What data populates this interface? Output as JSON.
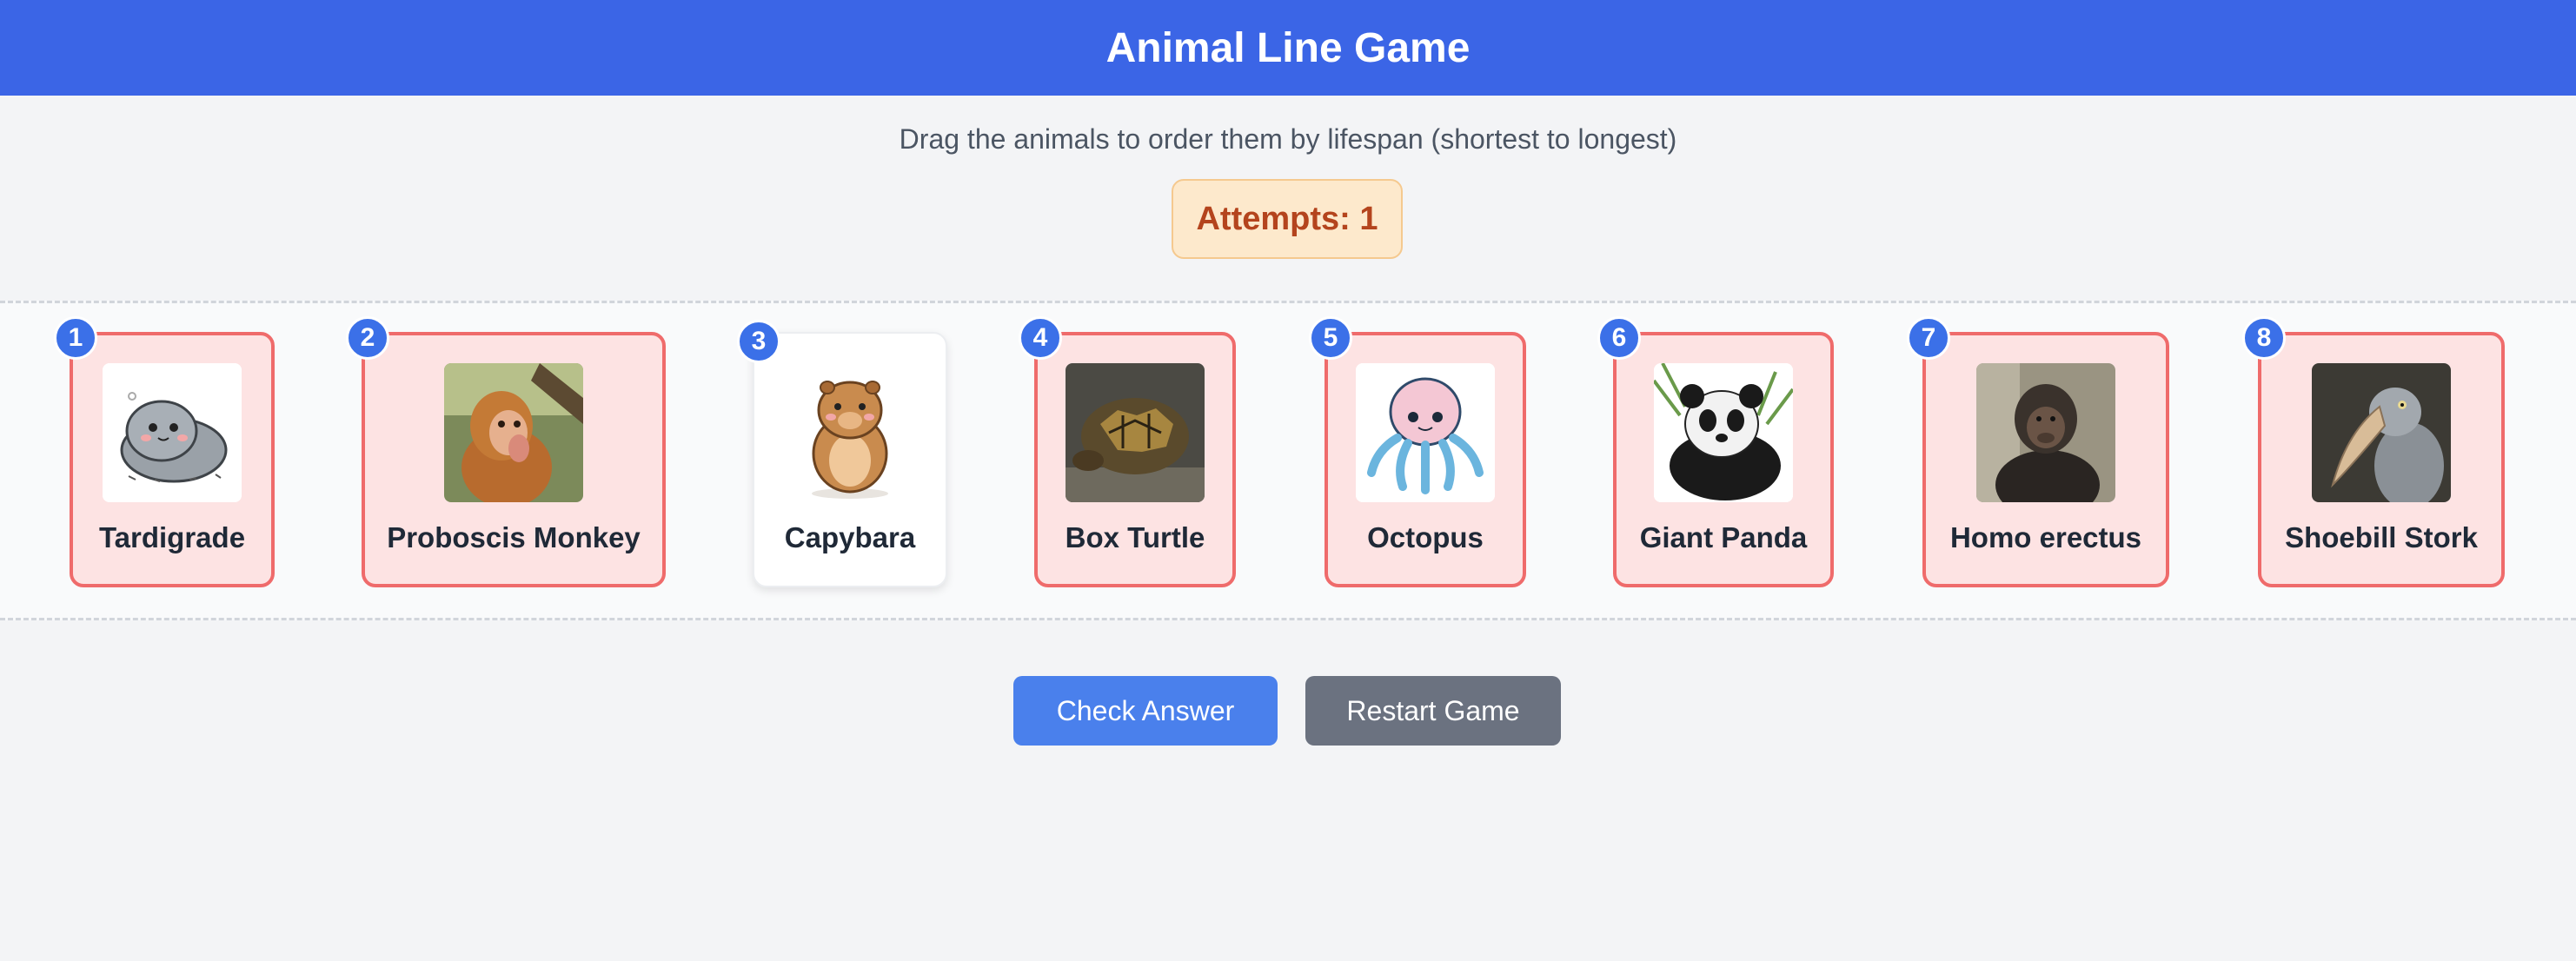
{
  "header": {
    "title": "Animal Line Game"
  },
  "instructions": "Drag the animals to order them by lifespan (shortest to longest)",
  "attempts_label": "Attempts: 1",
  "cards": [
    {
      "position": "1",
      "name": "Tardigrade",
      "status": "incorrect",
      "image": "tardigrade-cartoon"
    },
    {
      "position": "2",
      "name": "Proboscis Monkey",
      "status": "incorrect",
      "image": "monkey-photo"
    },
    {
      "position": "3",
      "name": "Capybara",
      "status": "correct",
      "image": "capybara-cartoon"
    },
    {
      "position": "4",
      "name": "Box Turtle",
      "status": "incorrect",
      "image": "turtle-photo"
    },
    {
      "position": "5",
      "name": "Octopus",
      "status": "incorrect",
      "image": "octopus-cartoon"
    },
    {
      "position": "6",
      "name": "Giant Panda",
      "status": "incorrect",
      "image": "panda-illustration"
    },
    {
      "position": "7",
      "name": "Homo erectus",
      "status": "incorrect",
      "image": "homo-erectus-photo"
    },
    {
      "position": "8",
      "name": "Shoebill Stork",
      "status": "incorrect",
      "image": "shoebill-photo"
    }
  ],
  "buttons": {
    "check": "Check Answer",
    "restart": "Restart Game"
  },
  "colors": {
    "header": "#3b65e6",
    "incorrect_fill": "#fde3e3",
    "incorrect_border": "#ef6b6b",
    "badge": "#3b70e8",
    "check_button": "#4a80ec",
    "restart_button": "#6b7280",
    "attempts_text": "#b4441d"
  }
}
